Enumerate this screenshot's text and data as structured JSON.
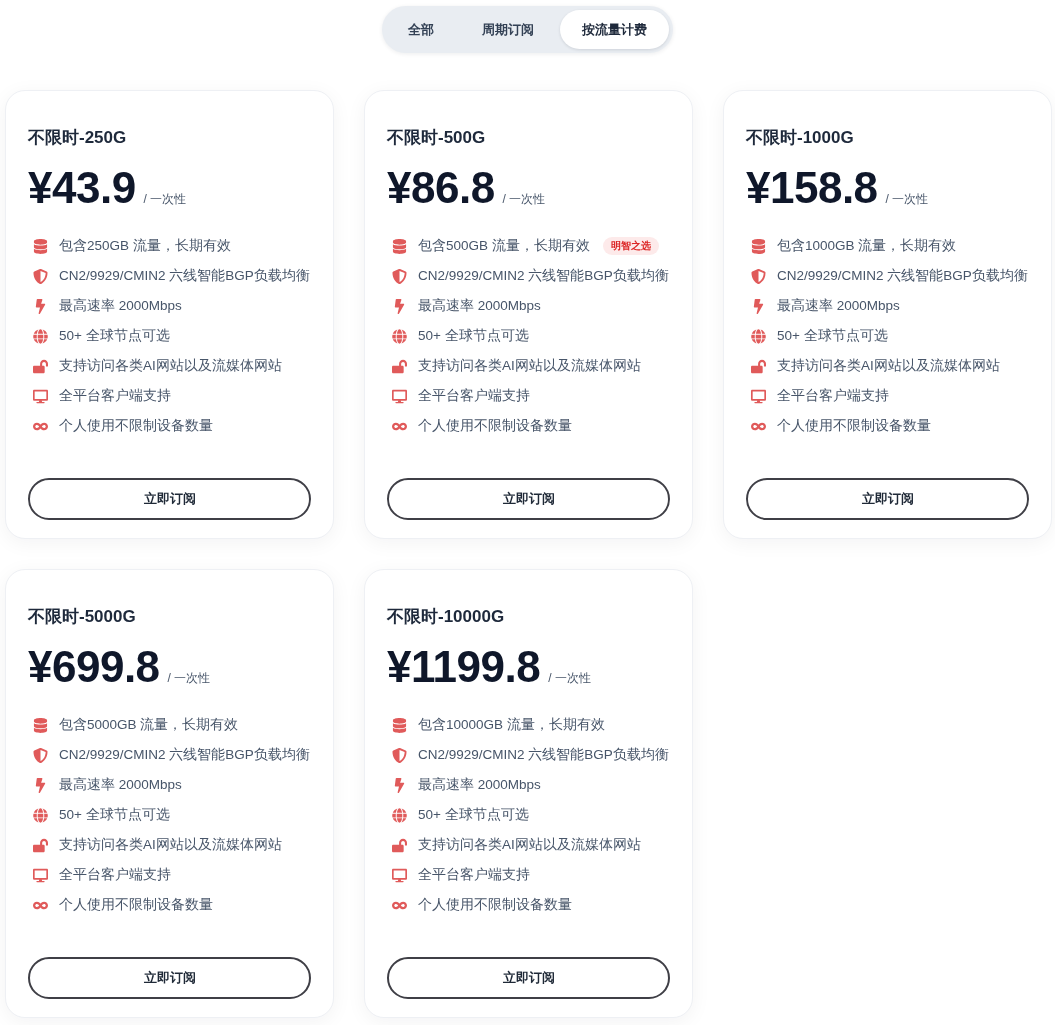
{
  "tabs": [
    {
      "label": "全部",
      "selected": false
    },
    {
      "label": "周期订阅",
      "selected": false
    },
    {
      "label": "按流量计费",
      "selected": true
    }
  ],
  "plans": [
    {
      "name": "不限时-250G",
      "price": "¥43.9",
      "period": "/ 一次性",
      "features": [
        {
          "kind": "database",
          "text": "包含250GB 流量，长期有效"
        },
        {
          "kind": "shield",
          "text": "CN2/9929/CMIN2 六线智能BGP负载均衡"
        },
        {
          "kind": "bolt",
          "text": "最高速率 2000Mbps"
        },
        {
          "kind": "globe",
          "text": "50+ 全球节点可选"
        },
        {
          "kind": "unlock",
          "text": "支持访问各类AI网站以及流媒体网站"
        },
        {
          "kind": "desktop",
          "text": "全平台客户端支持"
        },
        {
          "kind": "infinity",
          "text": "个人使用不限制设备数量"
        }
      ],
      "button": "立即订阅"
    },
    {
      "name": "不限时-500G",
      "price": "¥86.8",
      "period": "/ 一次性",
      "features": [
        {
          "kind": "database",
          "text": "包含500GB 流量，长期有效",
          "badge": "明智之选"
        },
        {
          "kind": "shield",
          "text": "CN2/9929/CMIN2 六线智能BGP负载均衡"
        },
        {
          "kind": "bolt",
          "text": "最高速率 2000Mbps"
        },
        {
          "kind": "globe",
          "text": "50+ 全球节点可选"
        },
        {
          "kind": "unlock",
          "text": "支持访问各类AI网站以及流媒体网站"
        },
        {
          "kind": "desktop",
          "text": "全平台客户端支持"
        },
        {
          "kind": "infinity",
          "text": "个人使用不限制设备数量"
        }
      ],
      "button": "立即订阅"
    },
    {
      "name": "不限时-1000G",
      "price": "¥158.8",
      "period": "/ 一次性",
      "features": [
        {
          "kind": "database",
          "text": "包含1000GB 流量，长期有效"
        },
        {
          "kind": "shield",
          "text": "CN2/9929/CMIN2 六线智能BGP负载均衡"
        },
        {
          "kind": "bolt",
          "text": "最高速率 2000Mbps"
        },
        {
          "kind": "globe",
          "text": "50+ 全球节点可选"
        },
        {
          "kind": "unlock",
          "text": "支持访问各类AI网站以及流媒体网站"
        },
        {
          "kind": "desktop",
          "text": "全平台客户端支持"
        },
        {
          "kind": "infinity",
          "text": "个人使用不限制设备数量"
        }
      ],
      "button": "立即订阅"
    },
    {
      "name": "不限时-5000G",
      "price": "¥699.8",
      "period": "/ 一次性",
      "features": [
        {
          "kind": "database",
          "text": "包含5000GB 流量，长期有效"
        },
        {
          "kind": "shield",
          "text": "CN2/9929/CMIN2 六线智能BGP负载均衡"
        },
        {
          "kind": "bolt",
          "text": "最高速率 2000Mbps"
        },
        {
          "kind": "globe",
          "text": "50+ 全球节点可选"
        },
        {
          "kind": "unlock",
          "text": "支持访问各类AI网站以及流媒体网站"
        },
        {
          "kind": "desktop",
          "text": "全平台客户端支持"
        },
        {
          "kind": "infinity",
          "text": "个人使用不限制设备数量"
        }
      ],
      "button": "立即订阅"
    },
    {
      "name": "不限时-10000G",
      "price": "¥1199.8",
      "period": "/ 一次性",
      "features": [
        {
          "kind": "database",
          "text": "包含10000GB 流量，长期有效"
        },
        {
          "kind": "shield",
          "text": "CN2/9929/CMIN2 六线智能BGP负载均衡"
        },
        {
          "kind": "bolt",
          "text": "最高速率 2000Mbps"
        },
        {
          "kind": "globe",
          "text": "50+ 全球节点可选"
        },
        {
          "kind": "unlock",
          "text": "支持访问各类AI网站以及流媒体网站"
        },
        {
          "kind": "desktop",
          "text": "全平台客户端支持"
        },
        {
          "kind": "infinity",
          "text": "个人使用不限制设备数量"
        }
      ],
      "button": "立即订阅"
    }
  ]
}
